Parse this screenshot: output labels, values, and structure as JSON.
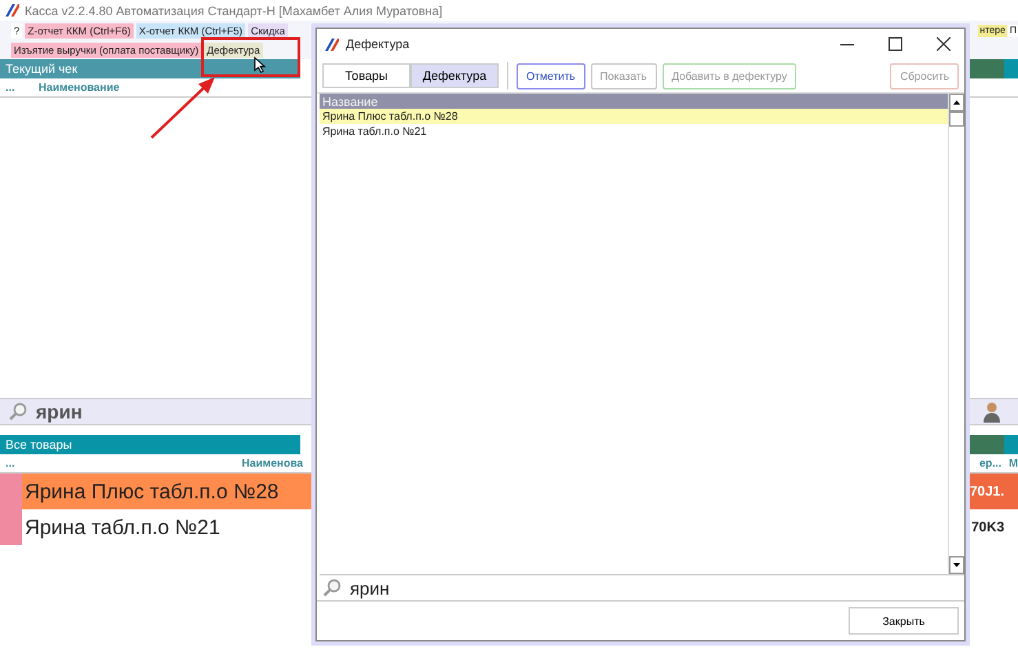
{
  "app": {
    "title": "Касса v2.2.4.80 Автоматизация Стандарт-Н [Махамбет Алия  Муратовна]"
  },
  "toolbar_rows": [
    [
      {
        "label": "?",
        "color": "#ffffff"
      },
      {
        "label": "Z-отчет ККМ (Ctrl+F6)",
        "color": "#f8b8c8"
      },
      {
        "label": "X-отчет ККМ (Ctrl+F5)",
        "color": "#c8e4f8"
      },
      {
        "label": "Скидка",
        "color": "#e6dcf6"
      }
    ],
    [
      {
        "label": "Изъятие выручки (оплата поставщику)",
        "color": "#f8b8c8"
      },
      {
        "label": "Дефектура",
        "color": "#e8e8d0"
      }
    ]
  ],
  "toolbar_right": [
    {
      "label": "нтере",
      "color": "#f4ec90"
    },
    {
      "label": "П",
      "color": "#ffffff"
    }
  ],
  "current_check": {
    "title": "Текущий чек",
    "columns": [
      "...",
      "Наименование"
    ],
    "search": "ярин"
  },
  "all_goods": {
    "title": "Все товары",
    "columns": [
      "...",
      "Наименова"
    ],
    "right_columns": [
      "ер...",
      "М"
    ],
    "rows": [
      {
        "name": "Ярина Плюс табл.п.о №28",
        "code": "70J1.",
        "selected": true
      },
      {
        "name": "Ярина табл.п.о №21",
        "code": "70K3",
        "selected": false
      }
    ]
  },
  "dialog": {
    "title": "Дефектура",
    "tabs": [
      {
        "label": "Товары",
        "selected": false
      },
      {
        "label": "Дефектура",
        "selected": true
      }
    ],
    "buttons": [
      {
        "label": "Отметить",
        "disabled": false,
        "color": "#8c8cf0"
      },
      {
        "label": "Показать",
        "disabled": true,
        "color": "#c8c8c8"
      },
      {
        "label": "Добавить в дефектуру",
        "disabled": true,
        "color": "#a8dca8"
      }
    ],
    "reset_button": {
      "label": "Сбросить",
      "disabled": true,
      "color": "#e8c0b8"
    },
    "list": {
      "header": "Название",
      "rows": [
        {
          "name": "Ярина Плюс табл.п.о №28",
          "selected": true
        },
        {
          "name": "Ярина табл.п.о №21",
          "selected": false
        }
      ]
    },
    "search": "ярин",
    "close_button": "Закрыть"
  }
}
